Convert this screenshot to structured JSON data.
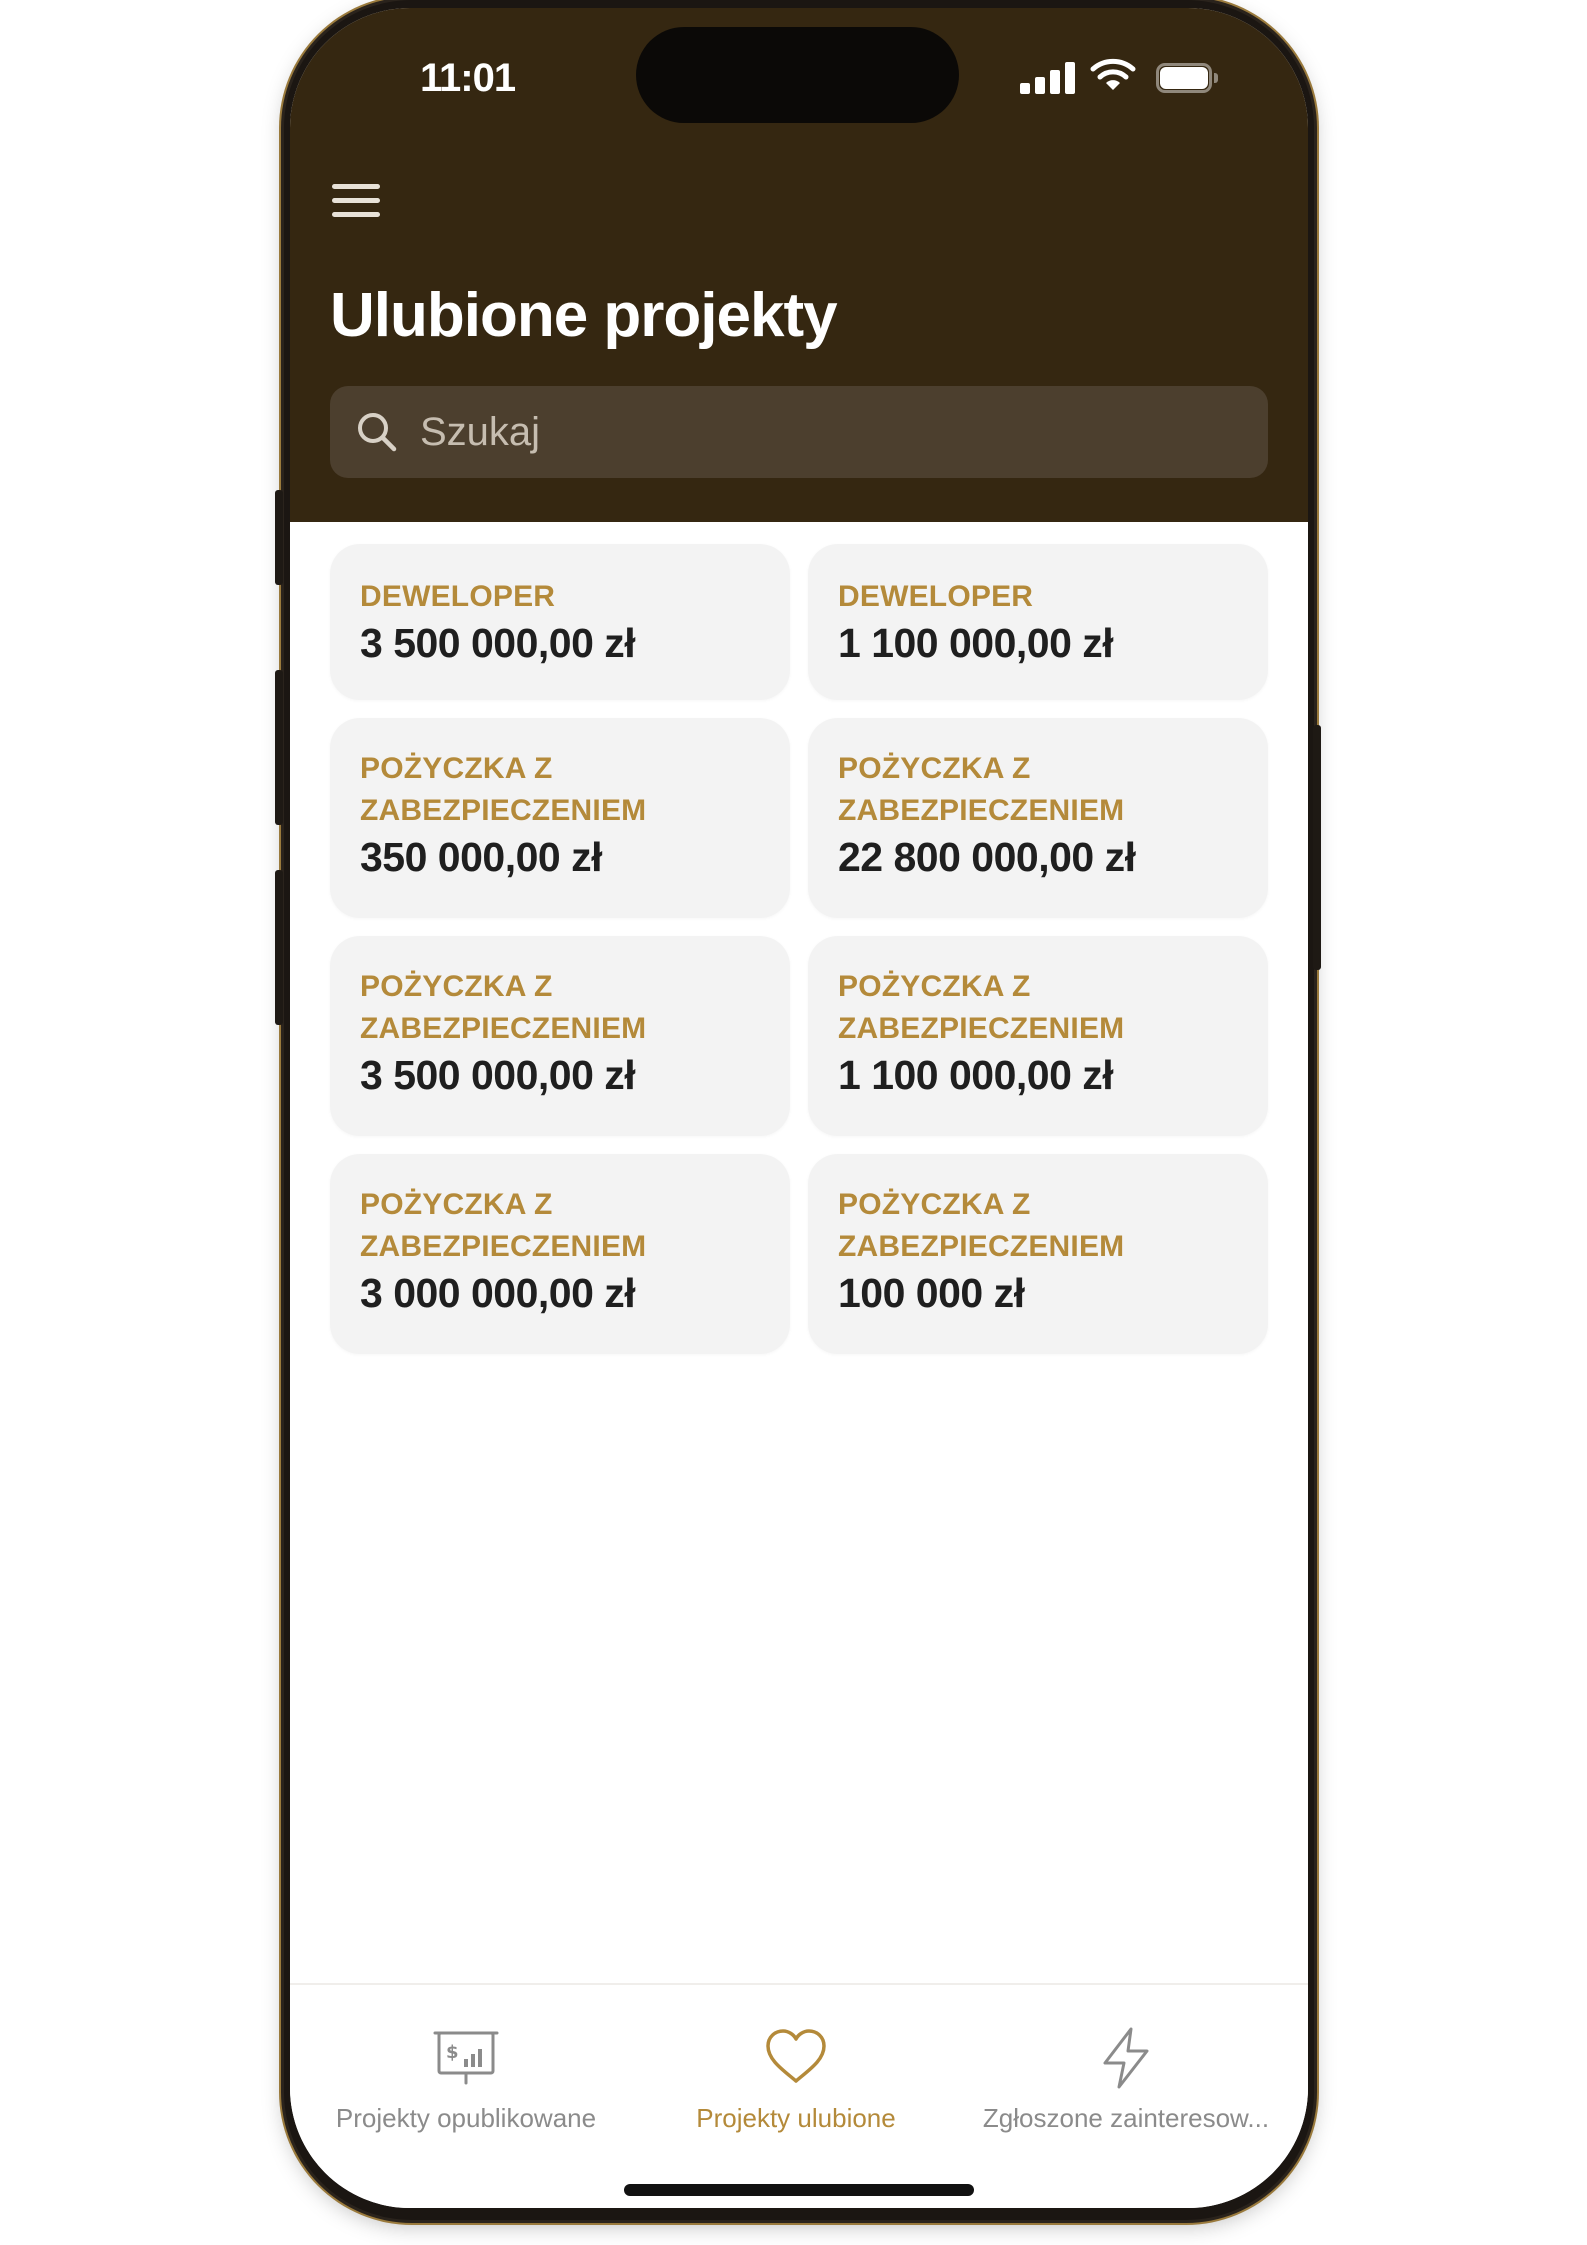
{
  "status_bar": {
    "time": "11:01"
  },
  "header": {
    "title": "Ulubione projekty"
  },
  "search": {
    "placeholder": "Szukaj"
  },
  "projects": [
    {
      "category": "DEWELOPER",
      "amount": "3 500 000,00 zł"
    },
    {
      "category": "DEWELOPER",
      "amount": "1 100 000,00 zł"
    },
    {
      "category": "POŻYCZKA Z\nZABEZPIECZENIEM",
      "amount": "350 000,00 zł"
    },
    {
      "category": "POŻYCZKA Z\nZABEZPIECZENIEM",
      "amount": "22 800 000,00 zł"
    },
    {
      "category": "POŻYCZKA Z\nZABEZPIECZENIEM",
      "amount": "3 500 000,00 zł"
    },
    {
      "category": "POŻYCZKA Z\nZABEZPIECZENIEM",
      "amount": "1 100 000,00 zł"
    },
    {
      "category": "POŻYCZKA Z\nZABEZPIECZENIEM",
      "amount": "3 000 000,00 zł"
    },
    {
      "category": "POŻYCZKA Z\nZABEZPIECZENIEM",
      "amount": "100 000 zł"
    }
  ],
  "tabbar": {
    "tabs": [
      {
        "label": "Projekty opublikowane",
        "icon": "presentation-chart-icon",
        "active": false
      },
      {
        "label": "Projekty ulubione",
        "icon": "heart-icon",
        "active": true
      },
      {
        "label": "Zgłoszone zainteresow...",
        "icon": "lightning-icon",
        "active": false
      }
    ]
  },
  "colors": {
    "header_bg": "#352711",
    "accent": "#B48A3A",
    "card_bg": "#F3F3F3",
    "search_bg": "#4C3F2E"
  }
}
